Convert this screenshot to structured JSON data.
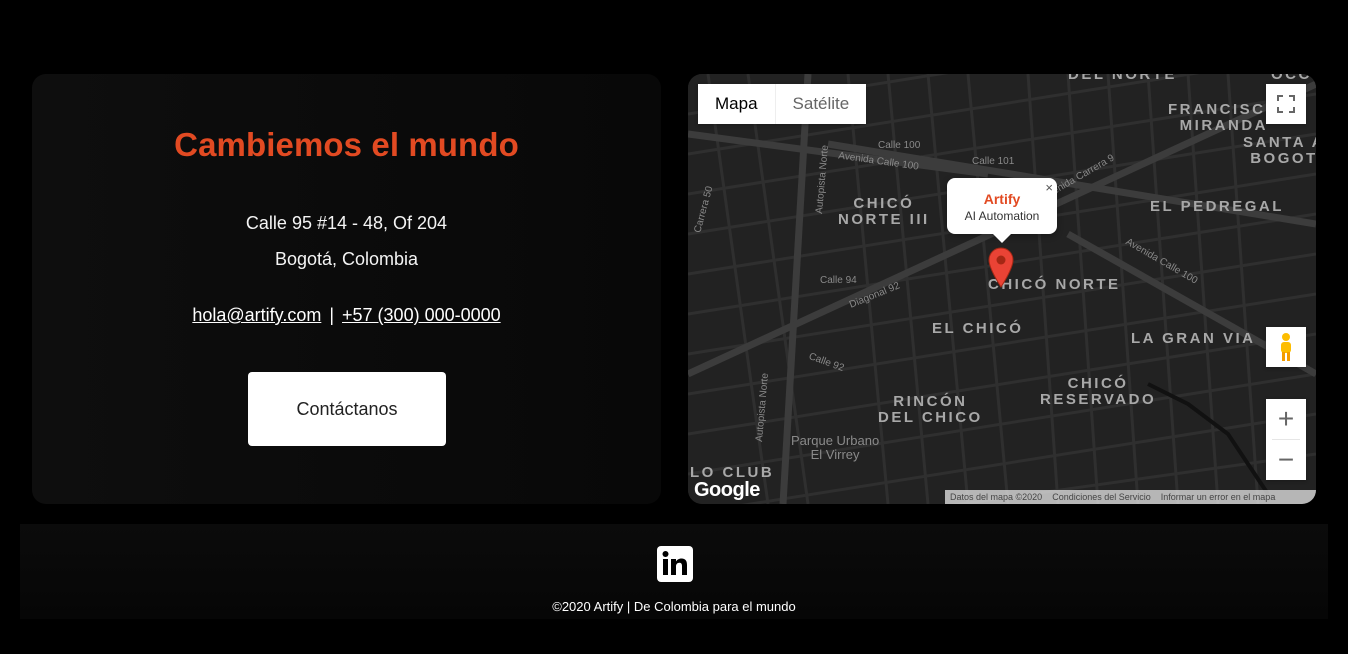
{
  "contact": {
    "title": "Cambiemos el mundo",
    "address_line1": "Calle 95 #14 - 48, Of 204",
    "address_line2": "Bogotá, Colombia",
    "email": "hola@artify.com",
    "separator": "|",
    "phone": "+57 (300) 000-0000",
    "button_label": "Contáctanos",
    "accent_color": "#e24a22"
  },
  "map": {
    "type_map": "Mapa",
    "type_satellite": "Satélite",
    "info_title": "Artify",
    "info_subtitle": "AI Automation",
    "close_symbol": "×",
    "zoom_in": "+",
    "zoom_out": "−",
    "google_logo": "Google",
    "attribution": [
      "Datos del mapa ©2020",
      "Condiciones del Servicio",
      "Informar un error en el mapa"
    ],
    "neighborhoods": {
      "chico_norte_iii": "CHICÓ\nNORTE III",
      "chico_norte": "CHICÓ NORTE",
      "el_chico": "EL CHICÓ",
      "el_pedregal": "EL PEDREGAL",
      "la_gran_via": "LA GRAN VIA",
      "chico_reservado": "CHICÓ\nRESERVADO",
      "rincon_del_chico": "RINCÓN\nDEL CHICO",
      "francisco_miranda": "FRANCISCO\nMIRANDA",
      "santa_bogota": "SANTA A\nBOGOT",
      "del_norte": "DEL NORTE",
      "lo_club": "LO CLUB",
      "octe": "OCCE"
    },
    "park": "Parque Urbano\nEl Virrey",
    "streets": {
      "avenida_calle_100": "Avenida Calle 100",
      "avenida_calle_100_b": "Avenida Calle 100",
      "calle_100": "Calle 100",
      "calle_101": "Calle 101",
      "calle_94": "Calle 94",
      "calle_92": "Calle 92",
      "diagonal_92": "Diagonal 92",
      "autopista_norte": "Autopista Norte",
      "autopista_norte_b": "Autopista Norte",
      "avenida_carrera_9": "Avenida Carrera 9",
      "carrera_50": "Carrera 50"
    }
  },
  "footer": {
    "social": "in",
    "copyright": "©2020 Artify | De Colombia para el mundo"
  }
}
